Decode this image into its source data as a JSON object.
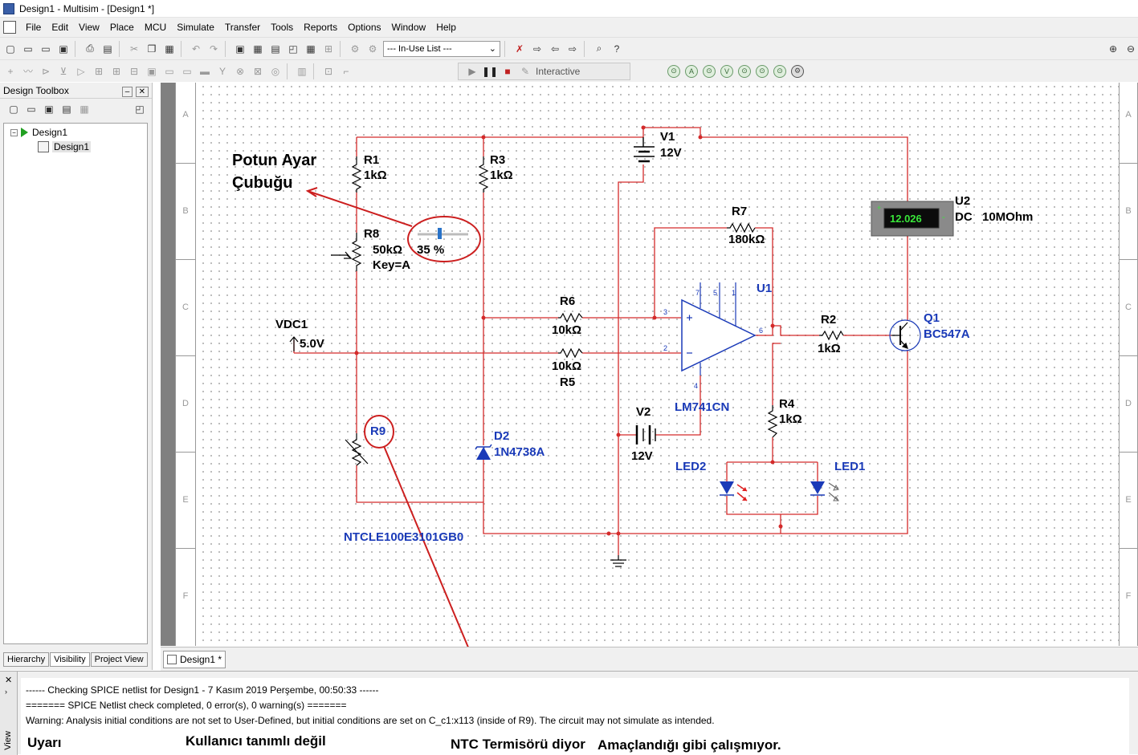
{
  "window": {
    "title": "Design1 - Multisim - [Design1 *]"
  },
  "menu": [
    "File",
    "Edit",
    "View",
    "Place",
    "MCU",
    "Simulate",
    "Transfer",
    "Tools",
    "Reports",
    "Options",
    "Window",
    "Help"
  ],
  "toolbar": {
    "in_use_list": "--- In-Use List ---",
    "interactive_label": "Interactive"
  },
  "toolbox": {
    "title": "Design Toolbox",
    "tree": {
      "root": "Design1",
      "child": "Design1"
    },
    "tabs": [
      "Hierarchy",
      "Visibility",
      "Project View"
    ]
  },
  "sheet_borders": [
    "A",
    "B",
    "C",
    "D",
    "E",
    "F"
  ],
  "circuit": {
    "annotation_potun": "Potun Ayar",
    "annotation_cubugu": "Çubuğu",
    "r1_ref": "R1",
    "r1_val": "1kΩ",
    "r3_ref": "R3",
    "r3_val": "1kΩ",
    "r8_ref": "R8",
    "r8_val": "50kΩ",
    "r8_key": "Key=A",
    "r8_pct": "35 %",
    "v1_ref": "V1",
    "v1_val": "12V",
    "u2_ref": "U2",
    "u2_dc": "DC",
    "u2_res": "10MOhm",
    "u2_reading": "12.026",
    "r7_ref": "R7",
    "r7_val": "180kΩ",
    "u1_ref": "U1",
    "u1_part": "LM741CN",
    "r6_ref": "R6",
    "r6_val": "10kΩ",
    "r5_ref": "R5",
    "r5_val": "10kΩ",
    "vdc1_ref": "VDC1",
    "vdc1_val": "5.0V",
    "r2_ref": "R2",
    "r2_val": "1kΩ",
    "q1_ref": "Q1",
    "q1_part": "BC547A",
    "v2_ref": "V2",
    "v2_val": "12V",
    "r4_ref": "R4",
    "r4_val": "1kΩ",
    "r9_ref": "R9",
    "r9_part": "NTCLE100E3101GB0",
    "d2_ref": "D2",
    "d2_part": "1N4738A",
    "led2_ref": "LED2",
    "led1_ref": "LED1",
    "pin3": "3",
    "pin2": "2",
    "pin6": "6",
    "pin7": "7",
    "pin5": "5",
    "pin1": "1",
    "pin4": "4"
  },
  "doc_tab": "Design1 *",
  "spreadsheet": {
    "side_label": "View",
    "line1": "------ Checking SPICE netlist for Design1 - 7 Kasım 2019 Perşembe, 00:50:33 ------",
    "line2": "======= SPICE Netlist check completed, 0 error(s), 0 warning(s) =======",
    "line3": "Warning: Analysis initial conditions are not set to User-Defined, but initial conditions are set on C_c1:x113 (inside of R9). The circuit may not simulate as intended."
  },
  "annotations": {
    "uyari": "Uyarı",
    "kullanici": "Kullanıcı tanımlı değil",
    "ntc": "NTC Termisörü diyor",
    "amac": "Amaçlandığı gibi çalışmıyor."
  },
  "colors": {
    "wire": "#d42a2a",
    "component_label": "#1a3ab8",
    "annotation_red": "#cc1f1f"
  }
}
